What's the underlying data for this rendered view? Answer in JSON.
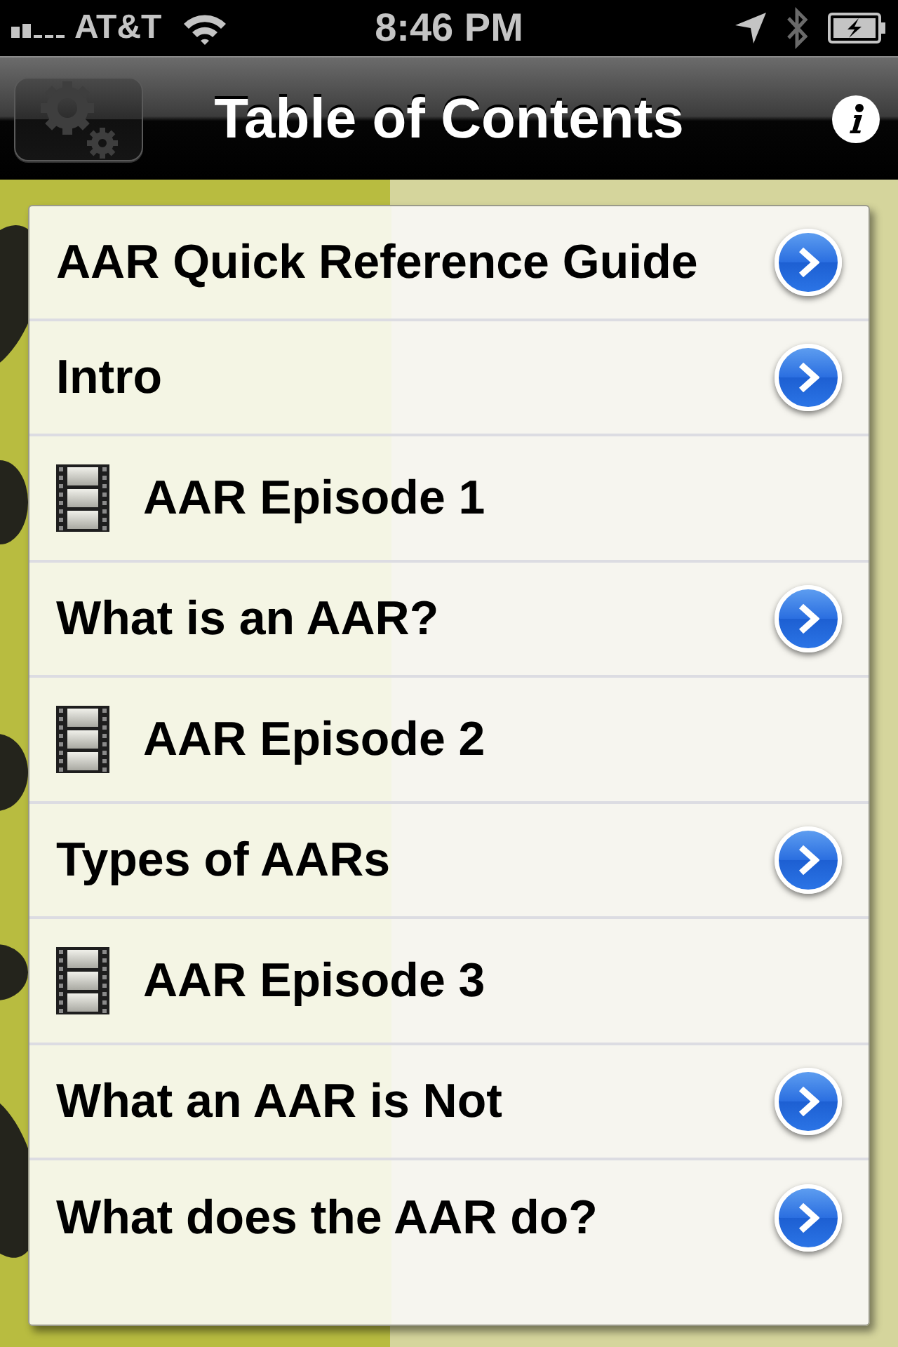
{
  "status_bar": {
    "carrier": "AT&T",
    "time": "8:46 PM"
  },
  "nav_bar": {
    "title": "Table of Contents"
  },
  "rows": [
    {
      "kind": "link",
      "label": "AAR Quick Reference Guide"
    },
    {
      "kind": "link",
      "label": "Intro"
    },
    {
      "kind": "video",
      "label": "AAR Episode 1"
    },
    {
      "kind": "link",
      "label": "What is an AAR?"
    },
    {
      "kind": "video",
      "label": "AAR Episode 2"
    },
    {
      "kind": "link",
      "label": "Types of AARs"
    },
    {
      "kind": "video",
      "label": "AAR Episode 3"
    },
    {
      "kind": "link",
      "label": "What an AAR is Not"
    },
    {
      "kind": "link",
      "label": "What does the AAR do?"
    }
  ]
}
